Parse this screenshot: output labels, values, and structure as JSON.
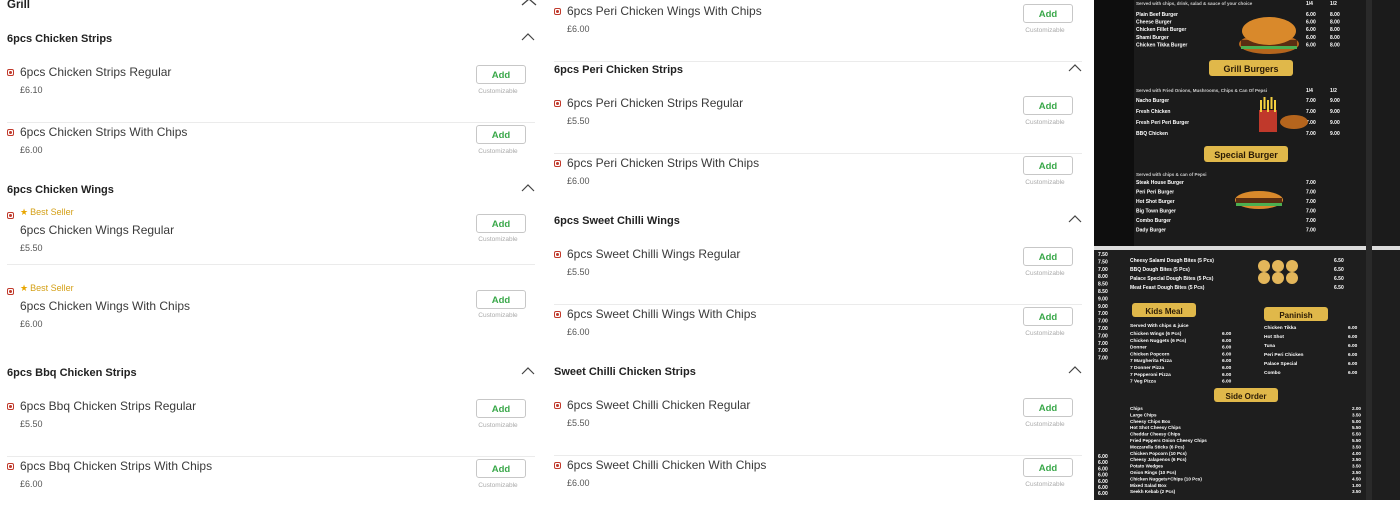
{
  "page_header": {
    "title": "Grill"
  },
  "button_label": "Add",
  "customizable_label": "Customizable",
  "best_seller_label": "Best Seller",
  "left_column": {
    "sections": [
      {
        "title": "6pcs Chicken Strips",
        "items": [
          {
            "name": "6pcs Chicken Strips Regular",
            "price": "£6.10"
          },
          {
            "name": "6pcs Chicken Strips With Chips",
            "price": "£6.00"
          }
        ]
      },
      {
        "title": "6pcs Chicken Wings",
        "items": [
          {
            "name": "6pcs Chicken Wings Regular",
            "price": "£5.50",
            "best_seller": true
          },
          {
            "name": "6pcs Chicken Wings With Chips",
            "price": "£6.00",
            "best_seller": true
          }
        ]
      },
      {
        "title": "6pcs Bbq Chicken Strips",
        "items": [
          {
            "name": "6pcs Bbq Chicken Strips Regular",
            "price": "£5.50"
          },
          {
            "name": "6pcs Bbq Chicken Strips With Chips",
            "price": "£6.00"
          }
        ]
      }
    ]
  },
  "middle_column": {
    "top_item": {
      "name": "6pcs Peri Chicken Wings With Chips",
      "price": "£6.00"
    },
    "sections": [
      {
        "title": "6pcs Peri Chicken Strips",
        "items": [
          {
            "name": "6pcs Peri Chicken Strips Regular",
            "price": "£5.50"
          },
          {
            "name": "6pcs Peri Chicken Strips With Chips",
            "price": "£6.00"
          }
        ]
      },
      {
        "title": "6pcs Sweet Chilli Wings",
        "items": [
          {
            "name": "6pcs Sweet Chilli Wings Regular",
            "price": "£5.50"
          },
          {
            "name": "6pcs Sweet Chilli Wings With Chips",
            "price": "£6.00"
          }
        ]
      },
      {
        "title": "Sweet Chilli Chicken Strips",
        "items": [
          {
            "name": "6pcs Sweet Chilli Chicken Regular",
            "price": "£5.50"
          },
          {
            "name": "6pcs Sweet Chilli Chicken With Chips",
            "price": "£6.00"
          }
        ]
      }
    ]
  },
  "menu_images": {
    "top_panel": {
      "intro": "Served with chips, drink, salad & sauce of your choice",
      "col_headers": [
        "1/4",
        "1/2"
      ],
      "items_a": [
        "Plain Beef Burger",
        "Cheese Burger",
        "Chicken Fillet Burger",
        "Shami Burger",
        "Chicken Tikka Burger"
      ],
      "prices_a": [
        [
          "6.00",
          "8.00"
        ],
        [
          "6.00",
          "8.00"
        ],
        [
          "6.00",
          "8.00"
        ],
        [
          "6.00",
          "8.00"
        ],
        [
          "6.00",
          "8.00"
        ]
      ],
      "banner_1": "Grill Burgers",
      "intro_2": "Served with Fried Onions, Mushrooms, Chips & Can Of Pepsi",
      "items_b": [
        "Nacho Burger",
        "Fresh Chicken",
        "Fresh Peri Peri Burger",
        "BBQ Chicken"
      ],
      "prices_b": [
        [
          "7.00",
          "9.00"
        ],
        [
          "7.00",
          "9.00"
        ],
        [
          "7.00",
          "9.00"
        ],
        [
          "7.00",
          "9.00"
        ]
      ],
      "banner_2": "Special Burger",
      "intro_3": "Served with chips & can of Pepsi",
      "items_c": [
        "Steak House Burger",
        "Peri Peri Burger",
        "Hot Shot Burger",
        "Big Town Burger",
        "Combo Burger",
        "Dady Burger"
      ],
      "prices_c": [
        "7.00",
        "7.00",
        "7.00",
        "7.00",
        "7.00",
        "7.00"
      ]
    },
    "bottom_panel": {
      "items_top": [
        "Cheesy Salami Dough Bites (5 Pcs)",
        "BBQ Dough Bites (5 Pcs)",
        "Palace Special Dough Bites (5 Pcs)",
        "Meat Feast Dough Bites (5 Pcs)"
      ],
      "prices_top": [
        "6.50",
        "6.50",
        "6.50",
        "6.50"
      ],
      "banner_kids": "Kids Meal",
      "banner_panini": "Paninish",
      "kids_intro": "Served With chips & juice",
      "kids_items": [
        "Chicken Wings (6 Pcs)",
        "Chicken Nuggets (6 Pcs)",
        "Donner",
        "Chicken Popcorn",
        "7 Margherita Pizza",
        "7 Donner Pizza",
        "7 Pepperoni Pizza",
        "7 Veg Pizza"
      ],
      "kids_prices": [
        "6.00",
        "6.00",
        "6.00",
        "6.00",
        "6.00",
        "6.00",
        "6.00",
        "6.00"
      ],
      "panini_items": [
        "Chicken Tikka",
        "Hot Shot",
        "Tuna",
        "Peri Peri Chicken",
        "Palace Special",
        "Combo"
      ],
      "panini_prices": [
        "6.00",
        "6.00",
        "6.00",
        "6.00",
        "6.00",
        "6.00"
      ],
      "banner_side": "Side Order",
      "side_items": [
        "Chips",
        "Large Chips",
        "Cheesy Chips Box",
        "Hot Shot Cheesy Chips",
        "Cheddar Cheesy Chips",
        "Fried Peppers Onion Cheesy Chips",
        "Mozzarella Sticks (6 Pcs)",
        "Chicken Popcorn (10 Pcs)",
        "Cheesy Jalapenos (6 Pcs)",
        "Potato Wedges",
        "Onion Rings (10 Pcs)",
        "Chicken Nuggets+Chips (10 Pcs)",
        "Mixed Salad Box",
        "Seekh Kebab (2 Pcs)"
      ],
      "side_prices": [
        "2.00",
        "3.50",
        "5.00",
        "5.50",
        "5.50",
        "5.50",
        "3.50",
        "4.00",
        "3.50",
        "3.50",
        "3.50",
        "4.50",
        "1.00",
        "3.50"
      ],
      "left_edge_prices": [
        "7.50",
        "7.50",
        "7.00",
        "8.00",
        "8.50",
        "8.50",
        "9.00",
        "9.00",
        "7.00",
        "7.00",
        "7.00",
        "7.00",
        "7.00",
        "7.00",
        "7.00"
      ],
      "left_edge_bottom": [
        "6.00",
        "6.00",
        "6.00",
        "6.00",
        "6.00",
        "6.00",
        "6.00"
      ]
    }
  },
  "colors": {
    "accent_green": "#3aa84a",
    "veg_red": "#c0392b",
    "best_seller": "#d4a017",
    "chalk_gold": "#e0b84a"
  }
}
